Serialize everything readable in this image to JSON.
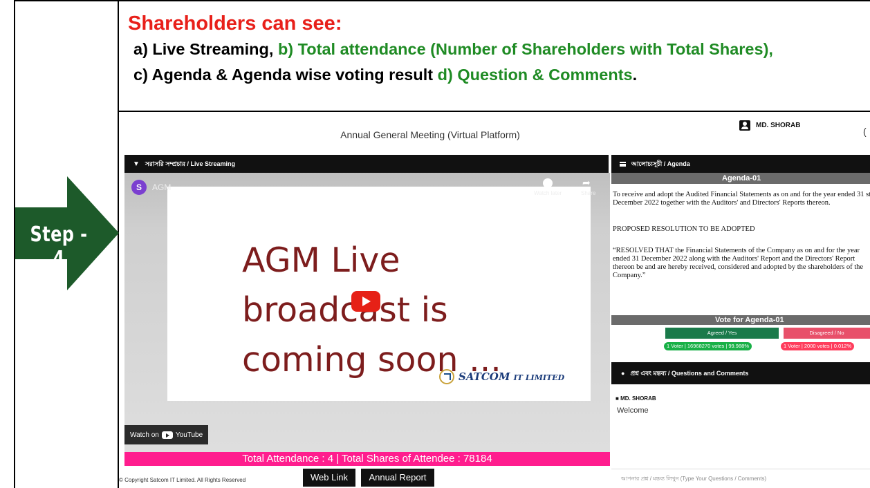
{
  "header": {
    "title": "Shareholders can see:",
    "line1_a": "a) Live Streaming, ",
    "line1_b": "b) Total attendance (Number of Shareholders with Total Shares),",
    "line2_c": "c) Agenda & Agenda wise voting result ",
    "line2_d": "d) Question & Comments",
    "line2_end": "."
  },
  "step_label": "Step - 4",
  "colors": {
    "arrow": "#1d5a2a",
    "title_red": "#e8201a",
    "green": "#1f8b24",
    "attendance_bar": "#ff1d8e"
  },
  "app": {
    "title": "Annual General Meeting (Virtual Platform)",
    "user": "MD. SHORAB",
    "header_extra": "(",
    "live_bar": "সরাসরি সম্প্রচার / Live Streaming",
    "agenda_bar": "আলোচ্যসূচী / Agenda",
    "video": {
      "channel_initial": "S",
      "channel": "AGM",
      "watch_later": "Watch later",
      "share": "Share",
      "slide_line1": "AGM Live",
      "slide_line2": "broadcast is",
      "slide_line3": "coming soon ...",
      "brand": "SATCOM",
      "brand_sub": "IT LIMITED",
      "watch_on": "Watch on",
      "youtube": "YouTube"
    },
    "attendance": "Total Attendance : 4 | Total Shares of Attendee : 78184",
    "footer": {
      "copyright": "© Copyright Satcom IT Limited. All Rights Reserved",
      "web_link": "Web Link",
      "annual_report": "Annual Report"
    },
    "agenda": {
      "heading": "Agenda-01",
      "para1": "To receive and adopt the Audited Financial Statements as on and for the year ended 31 st December 2022 together with the Auditors' and Directors' Reports thereon.",
      "para2": "PROPOSED RESOLUTION TO BE ADOPTED",
      "para3": "“RESOLVED THAT the Financial Statements of the Company as on and for the year ended 31 December 2022 along with the Auditors' Report and the Directors' Report thereon be and are hereby received, considered and adopted by the shareholders of the Company.”",
      "vote_heading": "Vote for Agenda-01",
      "agree": "Agreed / Yes",
      "disagree": "Disagreed / No",
      "agree_result": "1 Voter | 16968270 votes | 99.988%",
      "disagree_result": "1 Voter | 2000 votes | 0.012%"
    },
    "questions": {
      "bar": "প্রশ্ন এবং মন্তব্য / Questions and Comments",
      "user": "MD. SHORAB",
      "message": "Welcome",
      "placeholder": "আপনার প্রশ্ন / মন্তব্য লিখুন (Type Your Questions / Comments)"
    }
  }
}
